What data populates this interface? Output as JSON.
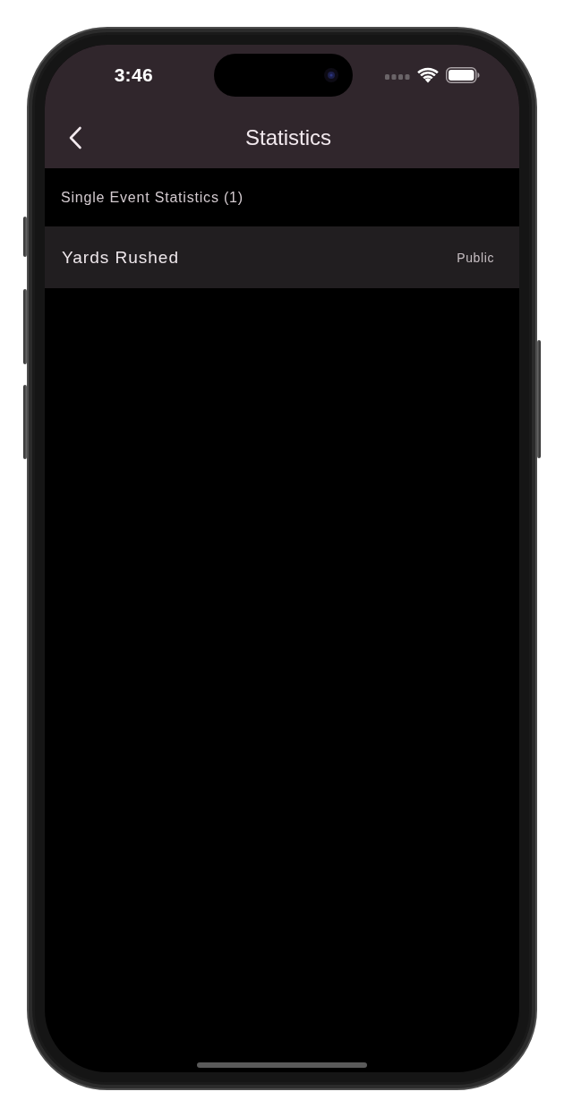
{
  "status_bar": {
    "time": "3:46"
  },
  "nav_bar": {
    "title": "Statistics"
  },
  "sections": [
    {
      "title": "Single Event Statistics (1)",
      "items": [
        {
          "name": "Yards Rushed",
          "visibility": "Public"
        }
      ]
    }
  ]
}
